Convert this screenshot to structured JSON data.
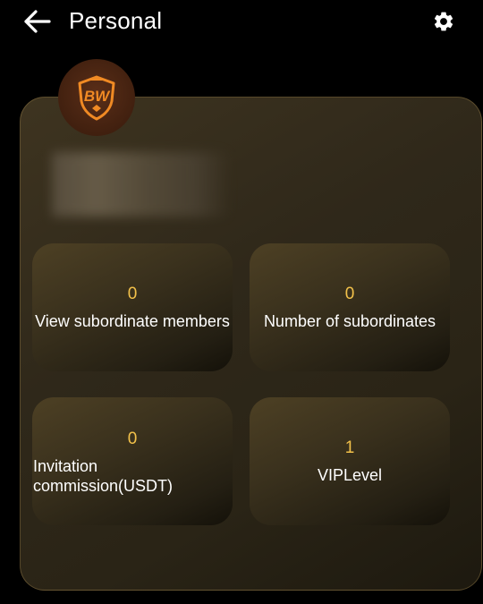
{
  "header": {
    "back_icon": "arrow-left-icon",
    "title": "Personal",
    "settings_icon": "gear-icon"
  },
  "profile": {
    "avatar_logo_text": "BW",
    "avatar_icon": "shield-logo-icon",
    "name_obscured": true
  },
  "stats": [
    {
      "value": "0",
      "label": "View subordinate members"
    },
    {
      "value": "0",
      "label": "Number of subordinates"
    },
    {
      "value": "0",
      "label": "Invitation commission(USDT)"
    },
    {
      "value": "1",
      "label": "VIPLevel"
    }
  ],
  "colors": {
    "background": "#000000",
    "value_accent": "#f2c14a",
    "logo_orange": "#f08a24",
    "card": "#2f281a"
  }
}
